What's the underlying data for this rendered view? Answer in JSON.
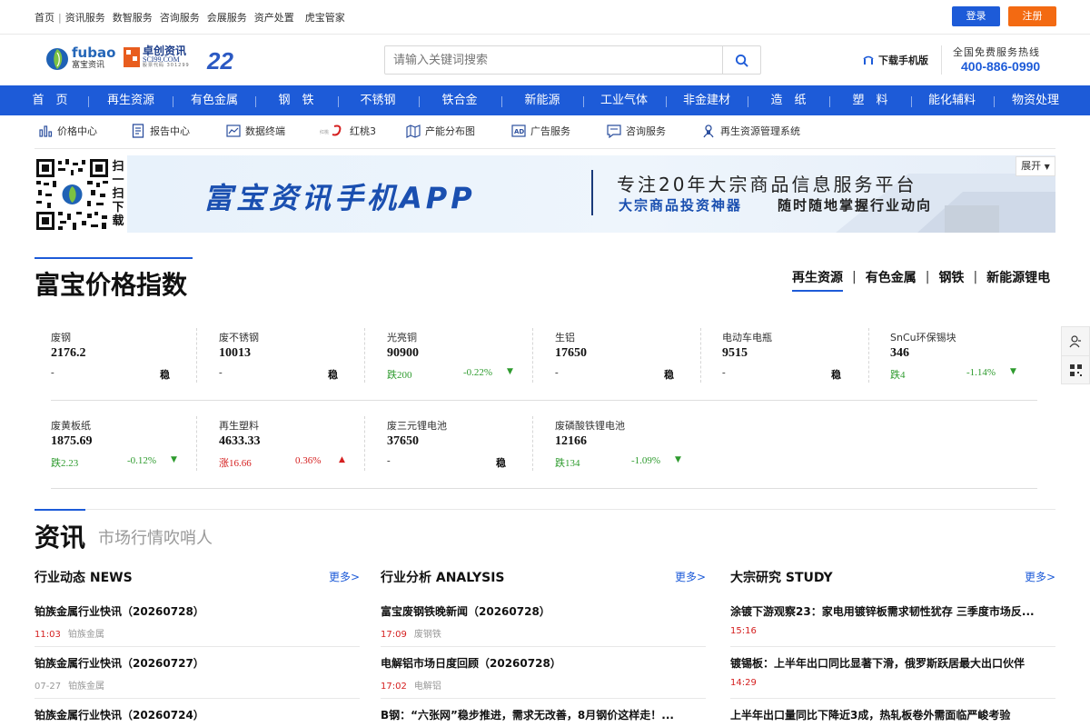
{
  "topbar": {
    "links": [
      "首页",
      "资讯服务",
      "数智服务",
      "咨询服务",
      "会展服务",
      "资产处置",
      "虎宝管家"
    ],
    "login": "登录",
    "register": "注册"
  },
  "header": {
    "logo_en": "fubao",
    "logo_cn": "富宝资讯",
    "partner_cn": "卓创资讯",
    "partner_en": "SCI99.COM",
    "partner_code": "股票代码 301299",
    "anniv": "22",
    "search_placeholder": "请输入关键词搜索",
    "download_app": "下载手机版",
    "hotline_label": "全国免费服务热线",
    "hotline": "400-886-0990"
  },
  "mainnav": [
    "首　页",
    "再生资源",
    "有色金属",
    "钢　铁",
    "不锈钢",
    "铁合金",
    "新能源",
    "工业气体",
    "非金建材",
    "造　纸",
    "塑　料",
    "能化辅料",
    "物资处理"
  ],
  "services": [
    "价格中心",
    "报告中心",
    "数据终端",
    "红桃3",
    "产能分布图",
    "广告服务",
    "咨询服务",
    "再生资源管理系统"
  ],
  "banner": {
    "scan_text": "扫一扫下载",
    "main": "富宝资讯手机APP",
    "slogan": "专注20年大宗商品信息服务平台",
    "tag1": "大宗商品投资神器",
    "tag2": "随时随地掌握行业动向",
    "expand": "展开"
  },
  "price_index": {
    "title": "富宝价格指数",
    "tabs": [
      "再生资源",
      "有色金属",
      "钢铁",
      "新能源锂电"
    ],
    "tab_sep": "|",
    "row1": [
      {
        "name": "废钢",
        "value": "2176.2",
        "change": "-",
        "pct": "",
        "status": "稳",
        "dir": "flat"
      },
      {
        "name": "废不锈钢",
        "value": "10013",
        "change": "-",
        "pct": "",
        "status": "稳",
        "dir": "flat"
      },
      {
        "name": "光亮铜",
        "value": "90900",
        "change": "跌200",
        "pct": "-0.22%",
        "status": "",
        "dir": "down"
      },
      {
        "name": "生铝",
        "value": "17650",
        "change": "-",
        "pct": "",
        "status": "稳",
        "dir": "flat"
      },
      {
        "name": "电动车电瓶",
        "value": "9515",
        "change": "-",
        "pct": "",
        "status": "稳",
        "dir": "flat"
      },
      {
        "name": "SnCu环保锡块",
        "value": "346",
        "change": "跌4",
        "pct": "-1.14%",
        "status": "",
        "dir": "down"
      }
    ],
    "row2": [
      {
        "name": "废黄板纸",
        "value": "1875.69",
        "change": "跌2.23",
        "pct": "-0.12%",
        "status": "",
        "dir": "down"
      },
      {
        "name": "再生塑料",
        "value": "4633.33",
        "change": "涨16.66",
        "pct": "0.36%",
        "status": "",
        "dir": "up"
      },
      {
        "name": "废三元锂电池",
        "value": "37650",
        "change": "-",
        "pct": "",
        "status": "稳",
        "dir": "flat"
      },
      {
        "name": "废磷酸铁锂电池",
        "value": "12166",
        "change": "跌134",
        "pct": "-1.09%",
        "status": "",
        "dir": "down"
      }
    ]
  },
  "news": {
    "title": "资讯",
    "subtitle": "市场行情吹哨人",
    "more": "更多>",
    "columns": [
      {
        "heading": "行业动态 NEWS",
        "articles": [
          {
            "title": "铂族金属行业快讯（20260728）",
            "time": "11:03",
            "tag": "铂族金属"
          },
          {
            "title": "铂族金属行业快讯（20260727）",
            "time": "07-27",
            "tag": "铂族金属"
          },
          {
            "title": "铂族金属行业快讯（20260724）",
            "time": "",
            "tag": ""
          }
        ]
      },
      {
        "heading": "行业分析 ANALYSIS",
        "articles": [
          {
            "title": "富宝废钢铁晚新闻（20260728）",
            "time": "17:09",
            "tag": "废钢铁"
          },
          {
            "title": "电解铝市场日度回顾（20260728）",
            "time": "17:02",
            "tag": "电解铝"
          },
          {
            "title": "B钢：“六张网”稳步推进，需求无改善，8月钢价这样走！...",
            "time": "",
            "tag": ""
          }
        ]
      },
      {
        "heading": "大宗研究 STUDY",
        "articles": [
          {
            "title": "涂镀下游观察23：家电用镀锌板需求韧性犹存 三季度市场反...",
            "time": "15:16",
            "tag": ""
          },
          {
            "title": "镀锡板：上半年出口同比显著下滑，俄罗斯跃居最大出口伙伴",
            "time": "14:29",
            "tag": ""
          },
          {
            "title": "上半年出口量同比下降近3成，热轧板卷外需面临严峻考验",
            "time": "",
            "tag": ""
          }
        ]
      }
    ]
  },
  "colors": {
    "primary": "#1d5bd8",
    "orange": "#f36a12",
    "down": "#2e9b2e",
    "up": "#d52020"
  }
}
